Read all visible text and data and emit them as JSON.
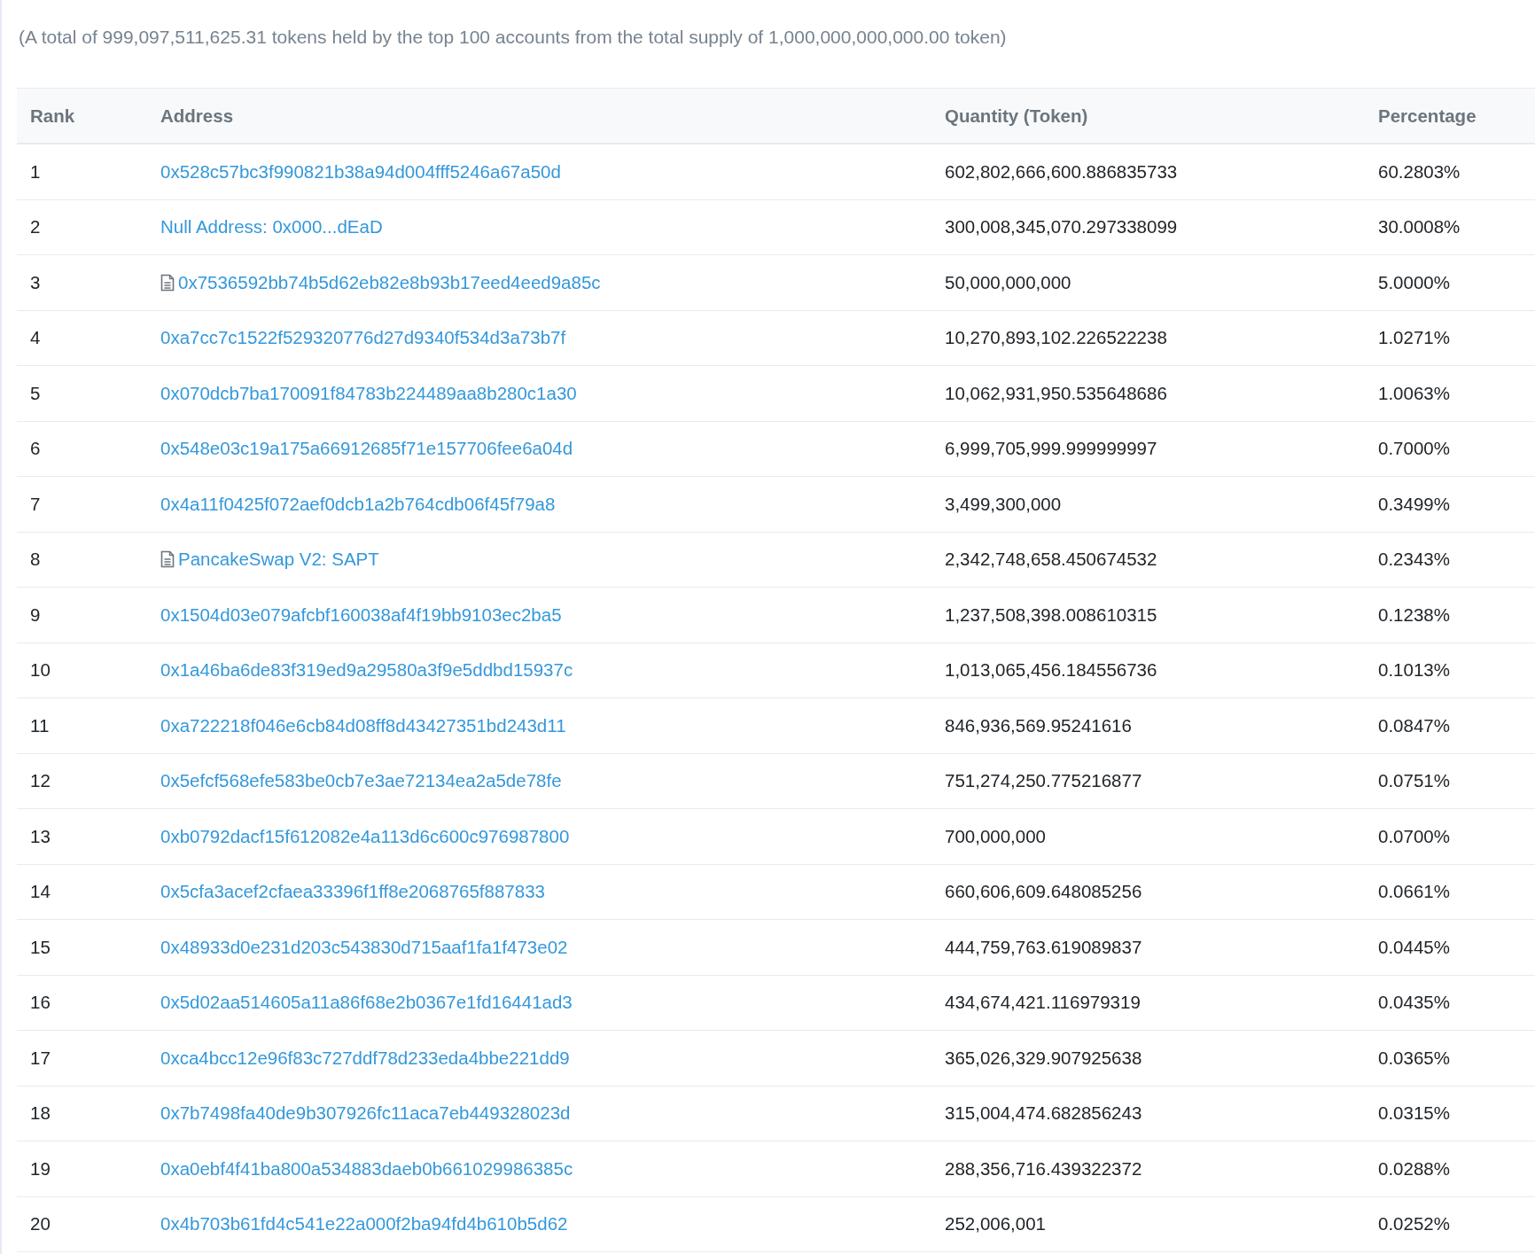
{
  "summary": "(A total of 999,097,511,625.31 tokens held by the top 100 accounts from the total supply of 1,000,000,000,000.00 token)",
  "table": {
    "columns": [
      "Rank",
      "Address",
      "Quantity (Token)",
      "Percentage"
    ],
    "rows": [
      {
        "rank": "1",
        "address": "0x528c57bc3f990821b38a94d004fff5246a67a50d",
        "contract": false,
        "quantity": "602,802,666,600.886835733",
        "percentage": "60.2803%"
      },
      {
        "rank": "2",
        "address": "Null Address: 0x000...dEaD",
        "contract": false,
        "quantity": "300,008,345,070.297338099",
        "percentage": "30.0008%"
      },
      {
        "rank": "3",
        "address": "0x7536592bb74b5d62eb82e8b93b17eed4eed9a85c",
        "contract": true,
        "quantity": "50,000,000,000",
        "percentage": "5.0000%"
      },
      {
        "rank": "4",
        "address": "0xa7cc7c1522f529320776d27d9340f534d3a73b7f",
        "contract": false,
        "quantity": "10,270,893,102.226522238",
        "percentage": "1.0271%"
      },
      {
        "rank": "5",
        "address": "0x070dcb7ba170091f84783b224489aa8b280c1a30",
        "contract": false,
        "quantity": "10,062,931,950.535648686",
        "percentage": "1.0063%"
      },
      {
        "rank": "6",
        "address": "0x548e03c19a175a66912685f71e157706fee6a04d",
        "contract": false,
        "quantity": "6,999,705,999.999999997",
        "percentage": "0.7000%"
      },
      {
        "rank": "7",
        "address": "0x4a11f0425f072aef0dcb1a2b764cdb06f45f79a8",
        "contract": false,
        "quantity": "3,499,300,000",
        "percentage": "0.3499%"
      },
      {
        "rank": "8",
        "address": "PancakeSwap V2: SAPT",
        "contract": true,
        "quantity": "2,342,748,658.450674532",
        "percentage": "0.2343%"
      },
      {
        "rank": "9",
        "address": "0x1504d03e079afcbf160038af4f19bb9103ec2ba5",
        "contract": false,
        "quantity": "1,237,508,398.008610315",
        "percentage": "0.1238%"
      },
      {
        "rank": "10",
        "address": "0x1a46ba6de83f319ed9a29580a3f9e5ddbd15937c",
        "contract": false,
        "quantity": "1,013,065,456.184556736",
        "percentage": "0.1013%"
      },
      {
        "rank": "11",
        "address": "0xa722218f046e6cb84d08ff8d43427351bd243d11",
        "contract": false,
        "quantity": "846,936,569.95241616",
        "percentage": "0.0847%"
      },
      {
        "rank": "12",
        "address": "0x5efcf568efe583be0cb7e3ae72134ea2a5de78fe",
        "contract": false,
        "quantity": "751,274,250.775216877",
        "percentage": "0.0751%"
      },
      {
        "rank": "13",
        "address": "0xb0792dacf15f612082e4a113d6c600c976987800",
        "contract": false,
        "quantity": "700,000,000",
        "percentage": "0.0700%"
      },
      {
        "rank": "14",
        "address": "0x5cfa3acef2cfaea33396f1ff8e2068765f887833",
        "contract": false,
        "quantity": "660,606,609.648085256",
        "percentage": "0.0661%"
      },
      {
        "rank": "15",
        "address": "0x48933d0e231d203c543830d715aaf1fa1f473e02",
        "contract": false,
        "quantity": "444,759,763.619089837",
        "percentage": "0.0445%"
      },
      {
        "rank": "16",
        "address": "0x5d02aa514605a11a86f68e2b0367e1fd16441ad3",
        "contract": false,
        "quantity": "434,674,421.116979319",
        "percentage": "0.0435%"
      },
      {
        "rank": "17",
        "address": "0xca4bcc12e96f83c727ddf78d233eda4bbe221dd9",
        "contract": false,
        "quantity": "365,026,329.907925638",
        "percentage": "0.0365%"
      },
      {
        "rank": "18",
        "address": "0x7b7498fa40de9b307926fc11aca7eb449328023d",
        "contract": false,
        "quantity": "315,004,474.682856243",
        "percentage": "0.0315%"
      },
      {
        "rank": "19",
        "address": "0xa0ebf4f41ba800a534883daeb0b661029986385c",
        "contract": false,
        "quantity": "288,356,716.439322372",
        "percentage": "0.0288%"
      },
      {
        "rank": "20",
        "address": "0x4b703b61fd4c541e22a000f2ba94fd4b610b5d62",
        "contract": false,
        "quantity": "252,006,001",
        "percentage": "0.0252%"
      }
    ]
  }
}
